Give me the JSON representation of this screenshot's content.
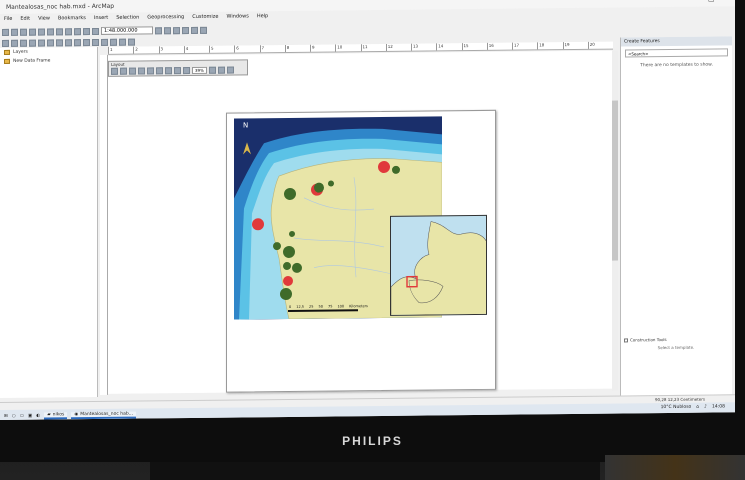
{
  "window": {
    "title": "Mantealosas_noc hab.mxd - ArcMap"
  },
  "menu": [
    "File",
    "Edit",
    "View",
    "Bookmarks",
    "Insert",
    "Selection",
    "Geoprocessing",
    "Customize",
    "Windows",
    "Help"
  ],
  "toolbar": {
    "scale_value": "1:48.000.000"
  },
  "toc": {
    "items": [
      {
        "label": "Layers",
        "icon": "layers-icon"
      },
      {
        "label": "New Data Frame",
        "icon": "layers-icon"
      }
    ]
  },
  "ruler": {
    "ticks": [
      "1",
      "2",
      "3",
      "4",
      "5",
      "6",
      "7",
      "8",
      "9",
      "10",
      "11",
      "12",
      "13",
      "14",
      "15",
      "16",
      "17",
      "18",
      "19",
      "20"
    ]
  },
  "layout_toolbar": {
    "title": "Layout",
    "zoom_value": "39%"
  },
  "map": {
    "north_label": "N",
    "scale_ticks": [
      "0",
      "12,5",
      "25",
      "50",
      "75",
      "100"
    ],
    "scale_unit": "Kilometers"
  },
  "right_panel": {
    "title": "Create Features",
    "dropdown": "<Search>",
    "message": "There are no templates to show.",
    "checkbox_label": "Construction Tools",
    "select_message": "Select a template."
  },
  "status": {
    "coords": "90,28  12,23 Centimeters"
  },
  "taskbar": {
    "apps": [
      {
        "label": "nikos",
        "icon": "folder-icon"
      },
      {
        "label": "Mantealosas_noc hab...",
        "icon": "arcmap-icon"
      }
    ],
    "weather": "10°C  Nubloso",
    "time": "14:08"
  },
  "monitor": {
    "brand": "PHILIPS"
  },
  "colors": {
    "ocean_deep": "#1a2f6b",
    "ocean_shelf": "#3aa7d8",
    "land": "#e8e5a8",
    "point_green": "#3f6b2a",
    "point_red": "#e0393b"
  }
}
